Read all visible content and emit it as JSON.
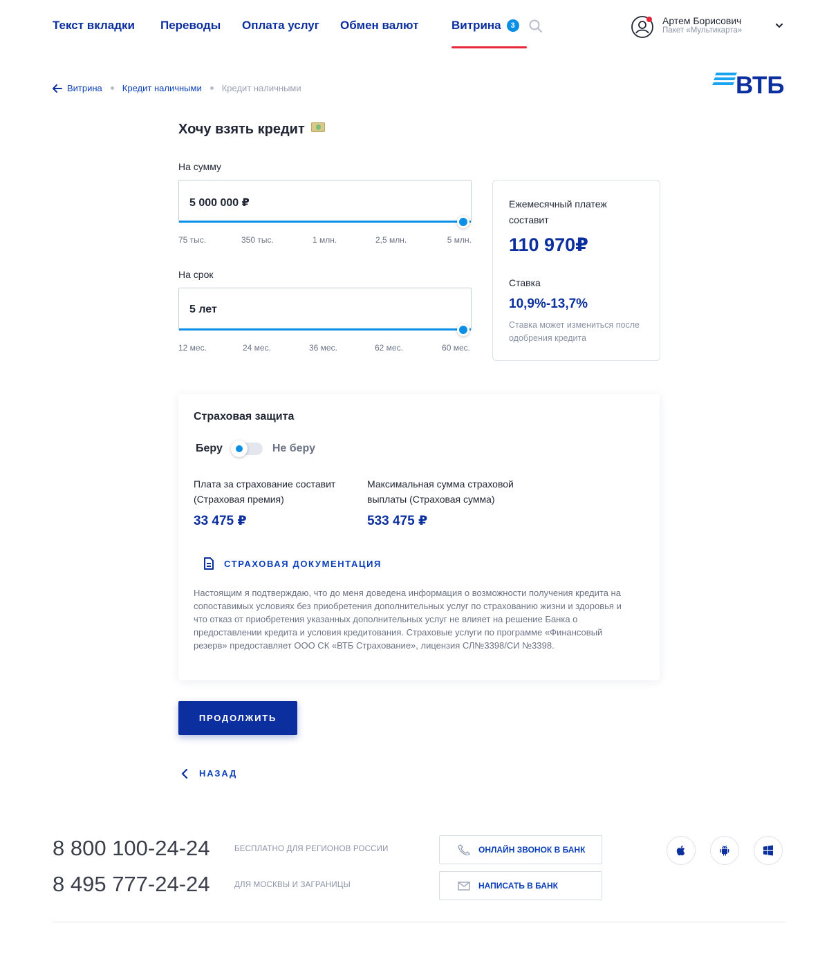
{
  "nav": {
    "tabs": [
      {
        "label": "Текст вкладки"
      },
      {
        "label": "Переводы"
      },
      {
        "label": "Оплата услуг"
      },
      {
        "label": "Обмен валют"
      },
      {
        "label": "Витрина",
        "badge": "3",
        "active": true
      }
    ],
    "user": {
      "name": "Артем Борисович",
      "plan": "Пакет «Мультикарта»"
    }
  },
  "breadcrumb": {
    "items": [
      "Витрина",
      "Кредит наличными",
      "Кредит наличными"
    ]
  },
  "logo": {
    "text": "ВТБ"
  },
  "page": {
    "title": "Хочу взять кредит"
  },
  "amount": {
    "label": "На сумму",
    "value": "5 000 000 ₽",
    "ticks": [
      "75 тыс.",
      "350 тыс.",
      "1 млн.",
      "2,5 млн.",
      "5 млн."
    ],
    "fill_fraction": 1.0
  },
  "term": {
    "label": "На срок",
    "value": "5 лет",
    "ticks": [
      "12 мес.",
      "24 мес.",
      "36 мес.",
      "62 мес.",
      "60 мес."
    ],
    "fill_fraction": 1.0
  },
  "summary": {
    "monthly_label_1": "Ежемесячный платеж",
    "monthly_label_2": "составит",
    "monthly_value": "110 970₽",
    "rate_label": "Ставка",
    "rate_value": "10,9%-13,7%",
    "rate_note": "Ставка может измениться после одобрения кредита"
  },
  "insurance": {
    "title": "Страховая защита",
    "toggle_on_label": "Беру",
    "toggle_off_label": "Не беру",
    "toggle_state": "Беру",
    "premium_label": "Плата за страхование составит (Страховая премия)",
    "premium_value": "33 475 ₽",
    "sum_label": "Максимальная сумма страховой выплаты (Страховая сумма)",
    "sum_value": "533 475 ₽",
    "doc_link": "СТРАХОВАЯ ДОКУМЕНТАЦИЯ",
    "disclaimer": "Настоящим я подтверждаю, что до меня доведена информация о  возможности получения кредита на сопоставимых условиях без приобретения дополнительных услуг  по страхованию жизни и здоровья и что отказ от приобретения указанных дополнительных услуг не влияет на решение Банка о предоставлении кредита и условия кредитования. Страховые услуги по программе «Финансовый резерв» предоставляет ООО СК «ВТБ Страхование», лицензия СЛ№3398/СИ №3398."
  },
  "actions": {
    "continue": "ПРОДОЛЖИТЬ",
    "back": "НАЗАД"
  },
  "footer": {
    "phone_1": "8 800 100-24-24",
    "phone_1_note": "БЕСПЛАТНО ДЛЯ РЕГИОНОВ РОССИИ",
    "phone_2": "8 495 777-24-24",
    "phone_2_note": "ДЛЯ МОСКВЫ И ЗАГРАНИЦЫ",
    "call_button": "ОНЛАЙН ЗВОНОК В БАНК",
    "write_button": "НАПИСАТЬ В БАНК",
    "stores": [
      "apple-icon",
      "android-icon",
      "windows-icon"
    ]
  },
  "colors": {
    "brand_blue": "#0b2f9e",
    "accent_blue": "#0a8fe6",
    "active_underline": "#e8263b"
  }
}
